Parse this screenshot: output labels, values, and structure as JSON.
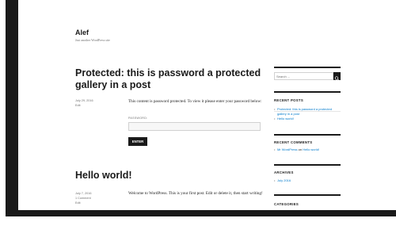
{
  "site": {
    "title": "Alef",
    "description": "Just another WordPress site"
  },
  "posts": [
    {
      "title": "Protected: this is password a protected gallery in a post",
      "date": "July 29, 2016",
      "edit": "Edit",
      "content": "This content is password protected. To view it please enter your password below:",
      "password_label": "PASSWORD:",
      "password_value": "",
      "submit_label": "ENTER"
    },
    {
      "title": "Hello world!",
      "date": "July 7, 2016",
      "comments": "1 Comment",
      "edit": "Edit",
      "content": "Welcome to WordPress. This is your first post. Edit or delete it, then start writing!"
    }
  ],
  "sidebar": {
    "search_placeholder": "Search ...",
    "search_icon": "search-icon",
    "recent_posts": {
      "title": "RECENT POSTS",
      "items": [
        "Protected: this is password a protected gallery in a post",
        "Hello world!"
      ]
    },
    "recent_comments": {
      "title": "RECENT COMMENTS",
      "author": "Mr WordPress",
      "on": "on",
      "post": "Hello world!"
    },
    "archives": {
      "title": "ARCHIVES",
      "items": [
        "July 2016"
      ]
    },
    "categories": {
      "title": "CATEGORIES"
    }
  },
  "colors": {
    "frame": "#1a1a1a",
    "link": "#007acc",
    "meta": "#707070"
  }
}
